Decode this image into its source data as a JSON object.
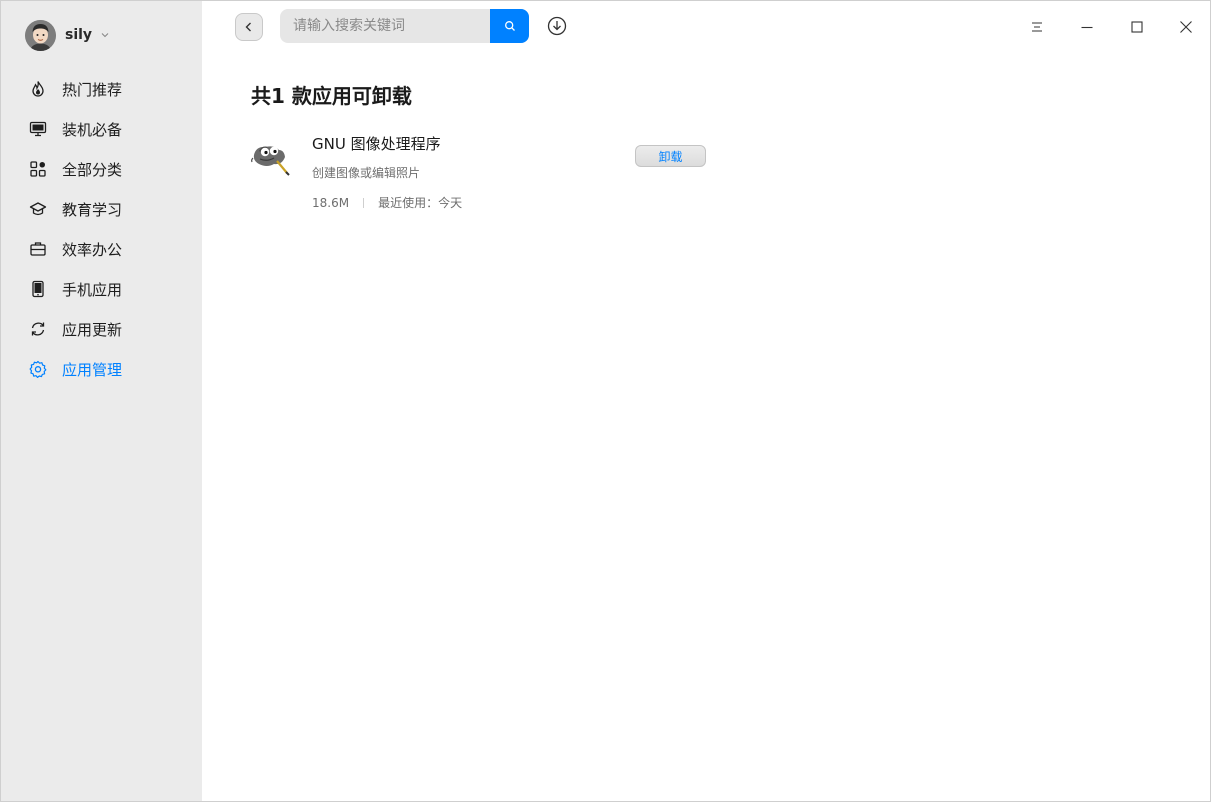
{
  "user": {
    "name": "sily"
  },
  "sidebar": {
    "items": [
      {
        "label": "热门推荐",
        "icon": "flame-icon",
        "active": false
      },
      {
        "label": "装机必备",
        "icon": "monitor-icon",
        "active": false
      },
      {
        "label": "全部分类",
        "icon": "grid-icon",
        "active": false
      },
      {
        "label": "教育学习",
        "icon": "graduation-cap-icon",
        "active": false
      },
      {
        "label": "效率办公",
        "icon": "briefcase-icon",
        "active": false
      },
      {
        "label": "手机应用",
        "icon": "phone-icon",
        "active": false
      },
      {
        "label": "应用更新",
        "icon": "refresh-icon",
        "active": false
      },
      {
        "label": "应用管理",
        "icon": "settings-gear-icon",
        "active": true
      }
    ]
  },
  "search": {
    "placeholder": "请输入搜索关键词",
    "value": ""
  },
  "main": {
    "heading": "共1 款应用可卸载",
    "apps": [
      {
        "name": "GNU 图像处理程序",
        "description": "创建图像或编辑照片",
        "size": "18.6M",
        "last_used": "最近使用：今天",
        "action_label": "卸载"
      }
    ]
  },
  "colors": {
    "accent": "#0081ff",
    "sidebar_bg": "#ebebeb"
  }
}
